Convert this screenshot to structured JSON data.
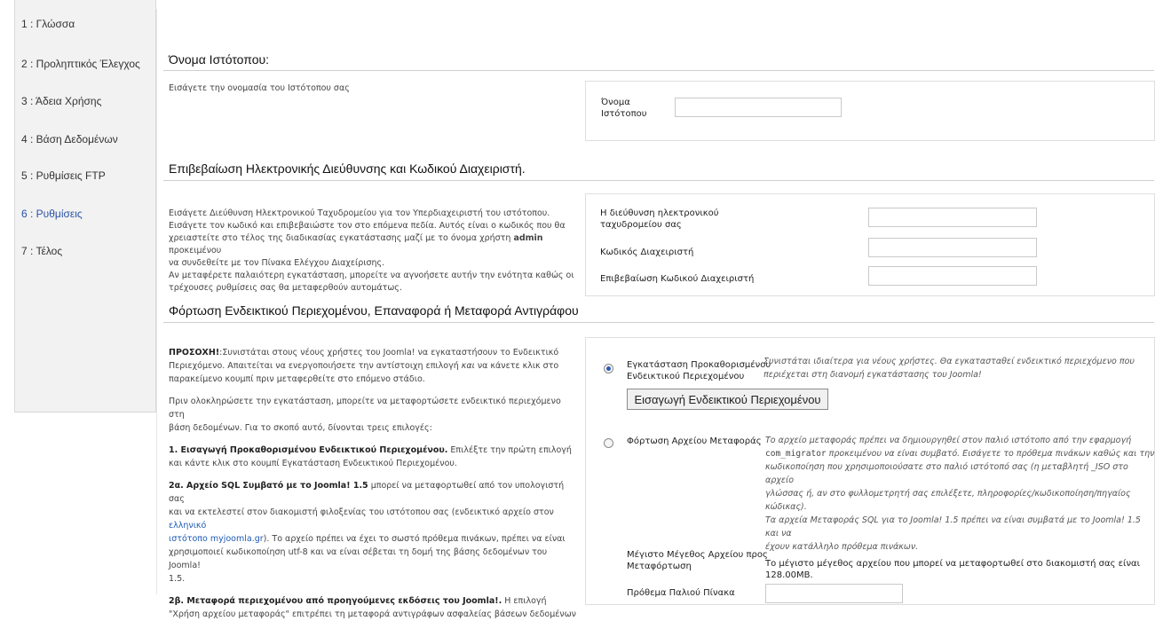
{
  "steps": [
    {
      "label": "1 : Γλώσσα",
      "active": false
    },
    {
      "label": "2 : Προληπτικός Έλεγχος",
      "active": false
    },
    {
      "label": "3 : Άδεια Χρήσης",
      "active": false
    },
    {
      "label": "4 : Βάση Δεδομένων",
      "active": false
    },
    {
      "label": "5 : Ρυθμίσεις FTP",
      "active": false
    },
    {
      "label": "6 : Ρυθμίσεις",
      "active": true
    },
    {
      "label": "7 : Τέλος",
      "active": false
    }
  ],
  "site_name": {
    "title": "Όνομα Ιστότοπου:",
    "description": "Εισάγετε την ονομασία του Ιστότοπου σας",
    "label_line1": "Όνομα",
    "label_line2": "Ιστότοπου",
    "value": ""
  },
  "admin": {
    "title": "Επιβεβαίωση Ηλεκτρονικής Διεύθυνσης και Κωδικού Διαχειριστή.",
    "desc_line1": "Εισάγετε Διεύθυνση Ηλεκτρονικού Ταχυδρομείου για τον Υπερδιαχειριστή του ιστότοπου.",
    "desc_line2": "Εισάγετε τον κωδικό και επιβεβαιώστε τον στο επόμενα πεδία. Αυτός είναι ο κωδικός που θα",
    "desc_line3_pre": "χρειαστείτε στο τέλος της διαδικασίας εγκατάστασης μαζί με το όνομα χρήστη ",
    "desc_line3_bold": "admin",
    "desc_line3_post": " προκειμένου",
    "desc_line4": "να συνδεθείτε με τον Πίνακα Ελέγχου Διαχείρισης.",
    "desc_line5": "Αν μεταφέρετε παλαιότερη εγκατάσταση, μπορείτε να αγνοήσετε αυτήν την ενότητα καθώς οι",
    "desc_line6": "τρέχουσες ρυθμίσεις σας θα μεταφερθούν αυτομάτως.",
    "email_label_line1": "Η διεύθυνση ηλεκτρονικού",
    "email_label_line2": "ταχυδρομείου σας",
    "password_label": "Κωδικός Διαχειριστή",
    "confirm_label": "Επιβεβαίωση Κωδικού Διαχειριστή"
  },
  "sample": {
    "title": "Φόρτωση Ενδεικτικού Περιεχομένου, Επαναφορά ή Μεταφορά Αντιγράφου",
    "p1_bold": "ΠΡΟΣΟΧΗ!",
    "p1_line1": ":Συνιστάται στους νέους χρήστες του Joomla! να εγκαταστήσουν το Ενδεικτικό",
    "p1_line2_pre": "Περιεχόμενο. Απαιτείται να ενεργοποιήσετε την αντίστοιχη επιλογή ",
    "p1_line2_em": "και",
    "p1_line2_post": " να κάνετε κλικ στο",
    "p1_line3": "παρακείμενο κουμπί πριν μεταφερθείτε στο επόμενο στάδιο.",
    "p2_line1": "Πριν ολοκληρώσετε την εγκατάσταση, μπορείτε να μεταφορτώσετε ενδεικτικό περιεχόμενο στη",
    "p2_line2": "βάση δεδομένων. Για το σκοπό αυτό, δίνονται τρεις επιλογές:",
    "opt1_bold": "1. Εισαγωγή Προκαθορισμένου Ενδεικτικού Περιεχομένου.",
    "opt1_rest": " Επιλέξτε την πρώτη επιλογή",
    "opt1_line2": "και κάντε κλικ στο κουμπί Εγκατάσταση Ενδεικτικού Περιεχομένου.",
    "opt2a_bold": "2α. Αρχείο SQL Συμβατό με το Joomla! 1.5",
    "opt2a_rest": " μπορεί να μεταφορτωθεί από τον υπολογιστή σας",
    "opt2a_line2_pre": "και να εκτελεστεί στον διακομιστή φιλοξενίας του ιστότοπου σας (ενδεικτικό αρχείο στον ",
    "opt2a_link1": "ελληνικό",
    "opt2a_link2": "ιστότοπο myjoomla.gr",
    "opt2a_line3_post": "). Το αρχείο πρέπει να έχει το σωστό πρόθεμα πινάκων, πρέπει να είναι",
    "opt2a_line4": "χρησιμοποιεί κωδικοποίηση utf-8 και να είναι σέβεται τη δομή της βάσης δεδομένων του Joomla!",
    "opt2a_line5": "1.5.",
    "opt2b_bold": "2β. Μεταφορά περιεχομένου από προηγούμενες εκδόσεις του Joomla!.",
    "opt2b_rest": " Η επιλογή",
    "opt2b_line2": "\"Χρήση αρχείου μεταφοράς\" επιτρέπει τη μεταφορά αντιγράφων ασφαλείας βάσεων δεδομένων",
    "install_label_line1": "Εγκατάσταση Προκαθορισμένου",
    "install_label_line2": "Ενδεικτικού Περιεχομένου",
    "install_note_line1": "Συνιστάται ιδιαίτερα για νέους χρήστες. Θα εγκατασταθεί ενδεικτικό περιεχόμενο που",
    "install_note_line2": "περιέχεται στη διανομή εγκατάστασης του Joomla!",
    "install_button": "Εισαγωγή Ενδεικτικού Περιεχομένου",
    "migrate_label": "Φόρτωση Αρχείου Μεταφοράς",
    "migrate_note_line1": "Το αρχείο μεταφοράς πρέπει να δημιουργηθεί στον παλιό ιστότοπο από την εφαρμογή",
    "migrate_note_code": "com_migrator",
    "migrate_note_line2_post": " προκειμένου να είναι συμβατό. Εισάγετε το πρόθεμα πινάκων καθώς και την",
    "migrate_note_line3": "κωδικοποίηση που χρησιμοποιούσατε στο παλιό ιστότοπό σας (η μεταβλητή _ISO στο αρχείο",
    "migrate_note_line4": "γλώσσας ή, αν στο φυλλομετρητή σας επιλέξετε, πληροφορίες/κωδικοποίηση/πηγαίος",
    "migrate_note_line5": "κώδικας).",
    "migrate_note_line6": "Τα αρχεία Μεταφοράς SQL για το Joomla! 1.5 πρέπει να είναι συμβατά με το Joomla! 1.5 και να",
    "migrate_note_line7": "έχουν κατάλληλο πρόθεμα πινάκων.",
    "max_label_line1": "Μέγιστο Μέγεθος Αρχείου προς",
    "max_label_line2": "Μεταφόρτωση",
    "max_value": "Το μέγιστο μέγεθος αρχείου που μπορεί να μεταφορτωθεί στο διακομιστή σας είναι 128.00MB.",
    "next_label": "Πρόθεμα Παλιού Πίνακα"
  }
}
